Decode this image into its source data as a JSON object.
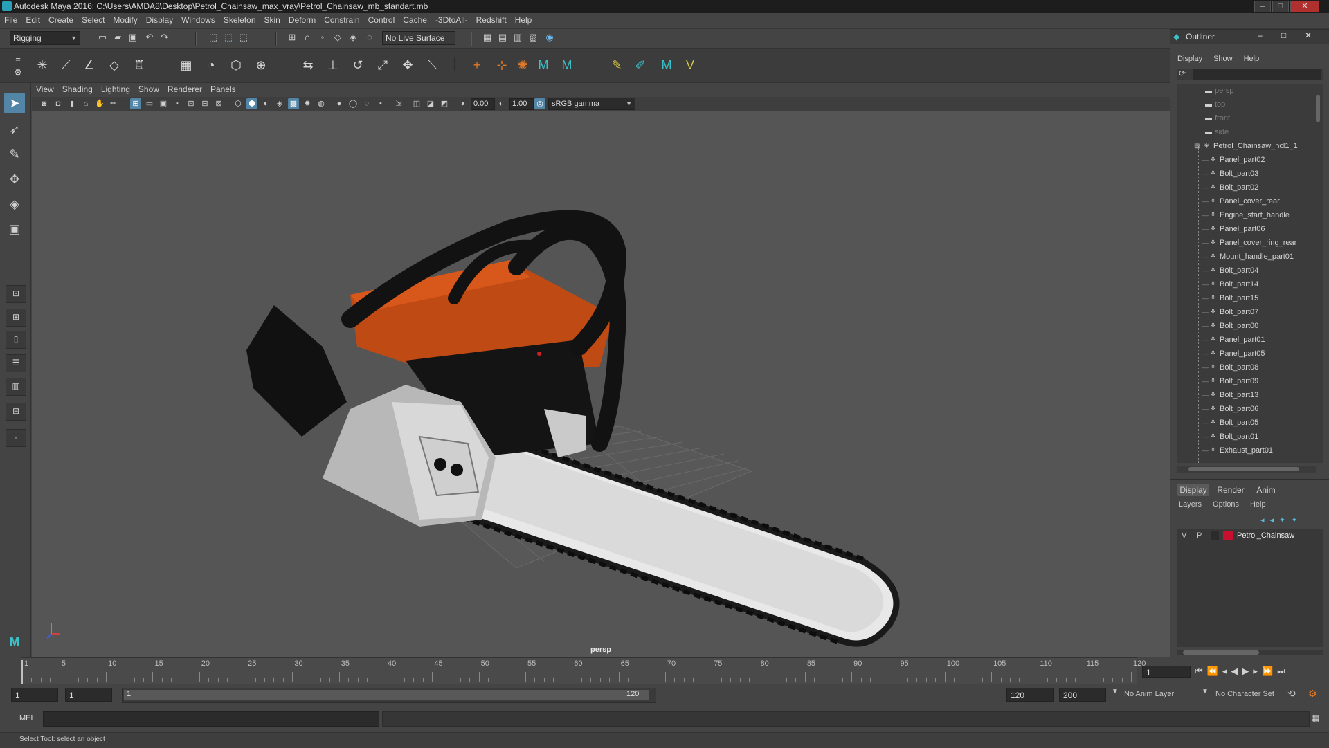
{
  "window": {
    "title": "Autodesk Maya 2016: C:\\Users\\AMDA8\\Desktop\\Petrol_Chainsaw_max_vray\\Petrol_Chainsaw_mb_standart.mb",
    "minimize": "–",
    "maximize": "□",
    "close": "✕"
  },
  "menubar": [
    "File",
    "Edit",
    "Create",
    "Select",
    "Modify",
    "Display",
    "Windows",
    "Skeleton",
    "Skin",
    "Deform",
    "Constrain",
    "Control",
    "Cache",
    "-3DtoAll-",
    "Redshift",
    "Help"
  ],
  "statusline": {
    "menuset": "Rigging",
    "live_surface": "No Live Surface"
  },
  "viewport": {
    "menu": [
      "View",
      "Shading",
      "Lighting",
      "Show",
      "Renderer",
      "Panels"
    ],
    "exposure": "0.00",
    "gamma": "1.00",
    "color_space": "sRGB gamma",
    "camera": "persp"
  },
  "outliner": {
    "title": "Outliner",
    "menu": [
      "Display",
      "Show",
      "Help"
    ],
    "cameras": [
      "persp",
      "top",
      "front",
      "side"
    ],
    "group": "Petrol_Chainsaw_ncl1_1",
    "children": [
      "Panel_part02",
      "Bolt_part03",
      "Bolt_part02",
      "Panel_cover_rear",
      "Engine_start_handle",
      "Panel_part06",
      "Panel_cover_ring_rear",
      "Mount_handle_part01",
      "Bolt_part04",
      "Bolt_part14",
      "Bolt_part15",
      "Bolt_part07",
      "Bolt_part00",
      "Panel_part01",
      "Panel_part05",
      "Bolt_part08",
      "Bolt_part09",
      "Bolt_part13",
      "Bolt_part06",
      "Bolt_part05",
      "Bolt_part01",
      "Exhaust_part01"
    ]
  },
  "layer_editor": {
    "tabs": [
      "Display",
      "Render",
      "Anim"
    ],
    "menu": [
      "Layers",
      "Options",
      "Help"
    ],
    "layer": {
      "v": "V",
      "p": "P",
      "name": "Petrol_Chainsaw",
      "color": "#c8102e"
    }
  },
  "timeline": {
    "tick_labels": [
      "1",
      "5",
      "10",
      "15",
      "20",
      "25",
      "30",
      "35",
      "40",
      "45",
      "50",
      "55",
      "60",
      "65",
      "70",
      "75",
      "80",
      "85",
      "90",
      "95",
      "100",
      "105",
      "110",
      "115",
      "120"
    ],
    "current_frame": "1"
  },
  "range": {
    "start": "1",
    "playback_start": "1",
    "slider_start": "1",
    "slider_end": "120",
    "playback_end": "120",
    "end": "200",
    "anim_layer": "No Anim Layer",
    "character_set": "No Character Set"
  },
  "commandline": {
    "label": "MEL"
  },
  "helpline": {
    "text": "Select Tool: select an object"
  }
}
